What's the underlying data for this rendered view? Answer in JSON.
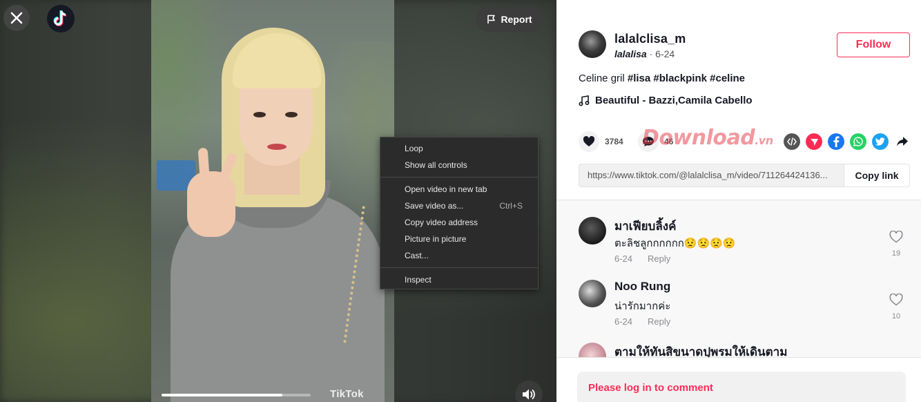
{
  "video": {
    "report_label": "Report",
    "watermark": "TikTok",
    "progress_fraction": 0.81
  },
  "context_menu": {
    "groups": [
      [
        {
          "label": "Loop",
          "shortcut": ""
        },
        {
          "label": "Show all controls",
          "shortcut": ""
        }
      ],
      [
        {
          "label": "Open video in new tab",
          "shortcut": ""
        },
        {
          "label": "Save video as...",
          "shortcut": "Ctrl+S"
        },
        {
          "label": "Copy video address",
          "shortcut": ""
        },
        {
          "label": "Picture in picture",
          "shortcut": ""
        },
        {
          "label": "Cast...",
          "shortcut": ""
        }
      ],
      [
        {
          "label": "Inspect",
          "shortcut": ""
        }
      ]
    ]
  },
  "author": {
    "username": "lalalclisa_m",
    "nickname": "lalalisa",
    "separator": " · ",
    "date": "6-24",
    "follow_label": "Follow"
  },
  "post": {
    "caption_text": "Celine gril ",
    "hashtags": [
      "#lisa",
      "#blackpink",
      "#celine"
    ],
    "music": "Beautiful - Bazzi,Camila Cabello"
  },
  "actions": {
    "likes": "3784",
    "comments": "46",
    "site_watermark": "Download",
    "site_watermark_suffix": ".vn"
  },
  "share_link": {
    "url": "https://www.tiktok.com/@lalalclisa_m/video/711264424136...",
    "copy_label": "Copy link"
  },
  "comments": [
    {
      "name": "มาเฟียบลิ้งค์",
      "text": "ตะลิชลูกกกกกก😟😟😟😟",
      "date": "6-24",
      "reply": "Reply",
      "likes": "19"
    },
    {
      "name": "Noo Rung",
      "text": "น่ารักมากค่ะ",
      "date": "6-24",
      "reply": "Reply",
      "likes": "10"
    },
    {
      "name": "ตามให้ทันสิขนาดปุพรมให้เดินตาม",
      "text": "",
      "date": "",
      "reply": "",
      "likes": ""
    }
  ],
  "login_prompt": "Please log in to comment",
  "colors": {
    "accent": "#fe2c55",
    "text_primary": "#161823",
    "text_secondary": "#8a8b91",
    "menu_bg": "#2b2b2b",
    "facebook": "#1877f2",
    "whatsapp": "#25d366",
    "twitter": "#1da1f2"
  }
}
